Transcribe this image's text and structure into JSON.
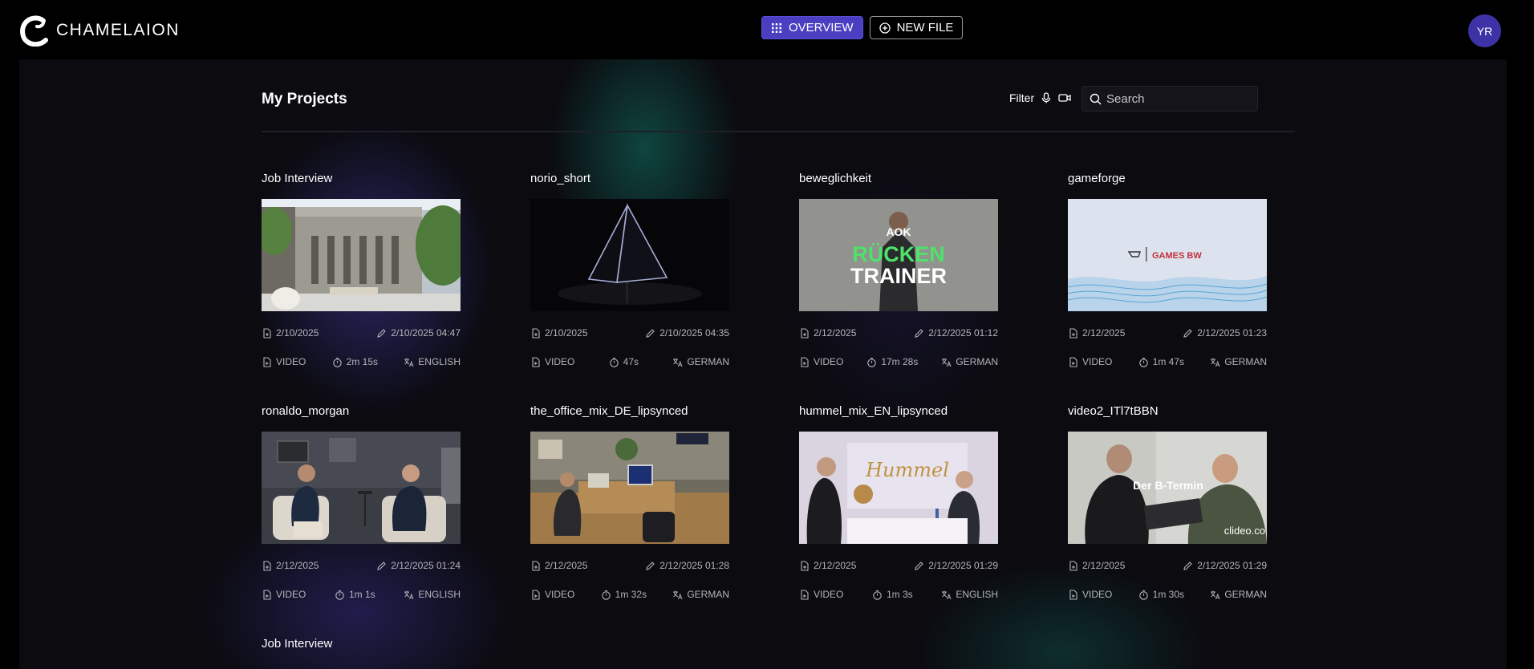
{
  "app": {
    "name": "CHAMELAION"
  },
  "nav": {
    "overview_label": "OVERVIEW",
    "new_file_label": "NEW FILE"
  },
  "user": {
    "initials": "YR"
  },
  "page": {
    "title": "My Projects",
    "filter_label": "Filter",
    "search_placeholder": "Search"
  },
  "colors": {
    "accent": "#4a3fc0",
    "avatar": "#3d33a6",
    "background": "#000000",
    "panel": "#0b0b10"
  },
  "projects": [
    {
      "title": "Job Interview",
      "created": "2/10/2025",
      "edited": "2/10/2025 04:47",
      "type": "VIDEO",
      "duration": "2m 15s",
      "language": "ENGLISH",
      "thumb": "building"
    },
    {
      "title": "norio_short",
      "created": "2/10/2025",
      "edited": "2/10/2025 04:35",
      "type": "VIDEO",
      "duration": "47s",
      "language": "GERMAN",
      "thumb": "pyramid"
    },
    {
      "title": "beweglichkeit",
      "created": "2/12/2025",
      "edited": "2/12/2025 01:12",
      "type": "VIDEO",
      "duration": "17m 28s",
      "language": "GERMAN",
      "thumb": "trainer",
      "thumb_texts": [
        "AOK",
        "RÜCKEN",
        "TRAINER"
      ]
    },
    {
      "title": "gameforge",
      "created": "2/12/2025",
      "edited": "2/12/2025 01:23",
      "type": "VIDEO",
      "duration": "1m 47s",
      "language": "GERMAN",
      "thumb": "games",
      "thumb_texts": [
        "GAMES BW"
      ]
    },
    {
      "title": "ronaldo_morgan",
      "created": "2/12/2025",
      "edited": "2/12/2025 01:24",
      "type": "VIDEO",
      "duration": "1m 1s",
      "language": "ENGLISH",
      "thumb": "interview"
    },
    {
      "title": "the_office_mix_DE_lipsynced",
      "created": "2/12/2025",
      "edited": "2/12/2025 01:28",
      "type": "VIDEO",
      "duration": "1m 32s",
      "language": "GERMAN",
      "thumb": "office"
    },
    {
      "title": "hummel_mix_EN_lipsynced",
      "created": "2/12/2025",
      "edited": "2/12/2025 01:29",
      "type": "VIDEO",
      "duration": "1m 3s",
      "language": "ENGLISH",
      "thumb": "hummel",
      "thumb_texts": [
        "Hummel"
      ]
    },
    {
      "title": "video2_ITl7tBBN",
      "created": "2/12/2025",
      "edited": "2/12/2025 01:29",
      "type": "VIDEO",
      "duration": "1m 30s",
      "language": "GERMAN",
      "thumb": "btermin",
      "thumb_texts": [
        "Der B-Termin",
        "clideo.co"
      ]
    },
    {
      "title": "Job Interview"
    }
  ]
}
